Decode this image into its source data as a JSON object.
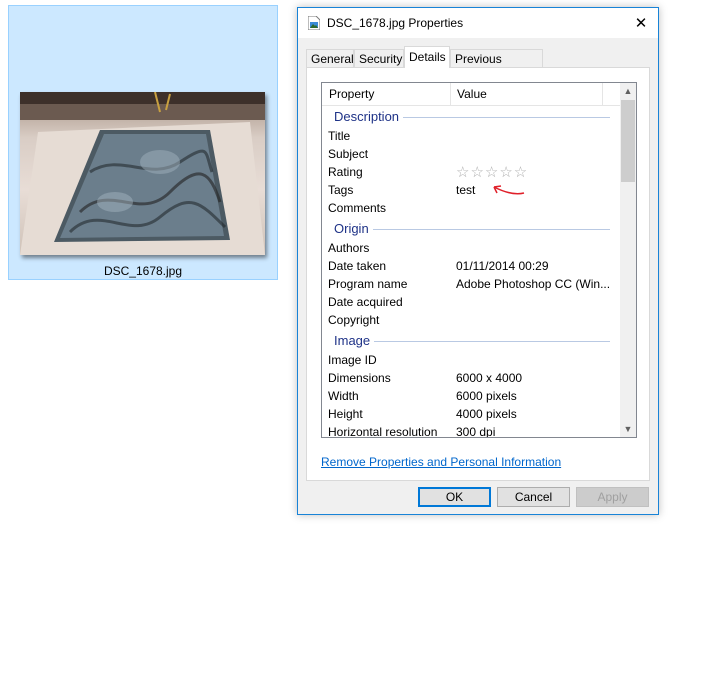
{
  "file": {
    "name": "DSC_1678.jpg"
  },
  "dialog": {
    "title": "DSC_1678.jpg Properties",
    "close_glyph": "✕",
    "tabs": [
      {
        "label": "General"
      },
      {
        "label": "Security"
      },
      {
        "label": "Details"
      },
      {
        "label": "Previous Versions"
      }
    ],
    "active_tab": "Details",
    "columns": {
      "property": "Property",
      "value": "Value"
    },
    "groups": {
      "description": {
        "label": "Description",
        "rows": {
          "title": {
            "property": "Title",
            "value": ""
          },
          "subject": {
            "property": "Subject",
            "value": ""
          },
          "rating": {
            "property": "Rating",
            "stars": "☆☆☆☆☆",
            "rating_value": 0
          },
          "tags": {
            "property": "Tags",
            "value": "test"
          },
          "comments": {
            "property": "Comments",
            "value": ""
          }
        }
      },
      "origin": {
        "label": "Origin",
        "rows": {
          "authors": {
            "property": "Authors",
            "value": ""
          },
          "date_taken": {
            "property": "Date taken",
            "value": "01/11/2014 00:29"
          },
          "program_name": {
            "property": "Program name",
            "value": "Adobe Photoshop CC (Win..."
          },
          "date_acquired": {
            "property": "Date acquired",
            "value": ""
          },
          "copyright": {
            "property": "Copyright",
            "value": ""
          }
        }
      },
      "image": {
        "label": "Image",
        "rows": {
          "image_id": {
            "property": "Image ID",
            "value": ""
          },
          "dimensions": {
            "property": "Dimensions",
            "value": "6000 x 4000"
          },
          "width": {
            "property": "Width",
            "value": "6000 pixels"
          },
          "height": {
            "property": "Height",
            "value": "4000 pixels"
          },
          "horizontal_resolution": {
            "property": "Horizontal resolution",
            "value": "300 dpi"
          }
        }
      }
    },
    "remove_link": "Remove Properties and Personal Information",
    "buttons": {
      "ok": "OK",
      "cancel": "Cancel",
      "apply": "Apply"
    },
    "scroll": {
      "up": "▲",
      "down": "▼"
    },
    "annotation_color": "#e0202a",
    "accent_color": "#0078d7"
  }
}
